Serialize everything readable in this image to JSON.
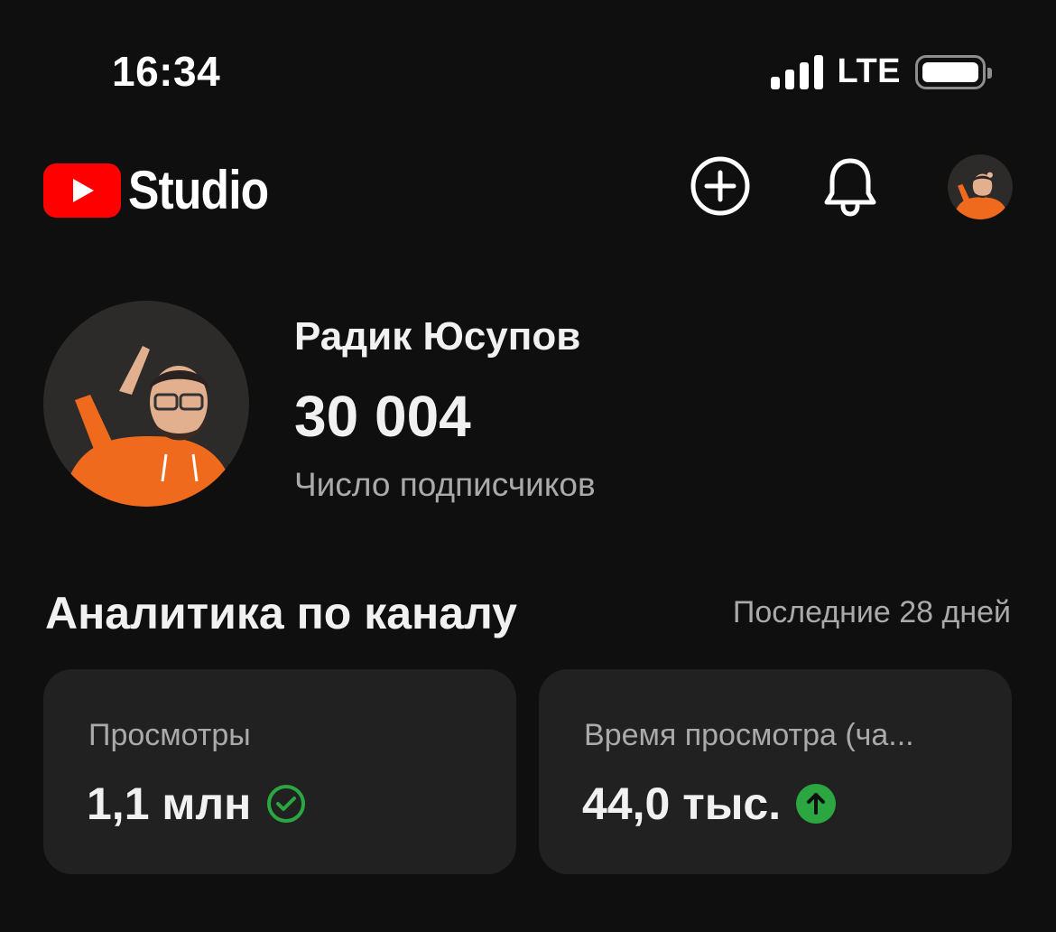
{
  "status_bar": {
    "time": "16:34",
    "network": "LTE",
    "signal_bars": 4,
    "battery_level": 1.0
  },
  "header": {
    "logo_text": "Studio",
    "logo_icon": "youtube-play-icon",
    "create_icon": "plus-circle-icon",
    "notifications_icon": "bell-icon",
    "brand_color": "#ff0000"
  },
  "channel": {
    "name": "Радик Юсупов",
    "subscriber_count": "30 004",
    "subscriber_label": "Число подписчиков"
  },
  "analytics": {
    "title": "Аналитика по каналу",
    "period": "Последние 28 дней",
    "cards": [
      {
        "label": "Просмотры",
        "value": "1,1 млн",
        "indicator_icon": "check-circle-icon",
        "indicator_color": "#2ba640"
      },
      {
        "label": "Время просмотра (ча...",
        "value": "44,0 тыс.",
        "indicator_icon": "arrow-up-circle-icon",
        "indicator_color": "#2ba640"
      }
    ]
  }
}
